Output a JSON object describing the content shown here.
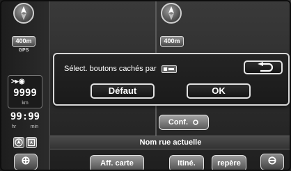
{
  "map": {
    "scale_left": "400m",
    "scale_right": "400m",
    "gps_label": "GPS",
    "distance": "9999",
    "distance_unit": "km",
    "time": "99:99",
    "time_unit_hr": "hr",
    "time_unit_min": "min",
    "street_name": "Nom rue actuelle"
  },
  "dialog": {
    "message": "Sélect. boutons cachés par",
    "default_label": "Défaut",
    "ok_label": "OK"
  },
  "buttons": {
    "conf_label": "Conf.",
    "aff_carte_label": "Aff. carte",
    "itine_label": "Itiné.",
    "repere_label": "repère",
    "zoom_in_symbol": "⊕",
    "zoom_out_symbol": "⊖"
  },
  "icons": {
    "compass": "compass-icon",
    "back": "return-arrow-icon",
    "destination": "destination-flag-icon"
  }
}
